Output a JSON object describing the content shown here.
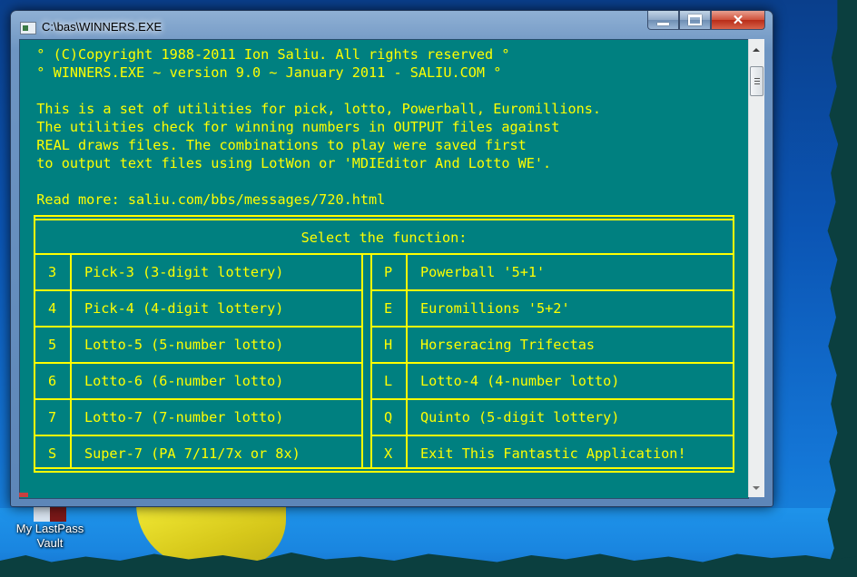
{
  "desktop": {
    "icon_label_line1": "My LastPass",
    "icon_label_line2": "Vault"
  },
  "window": {
    "title": "C:\\bas\\WINNERS.EXE",
    "buttons": {
      "minimize": "minimize",
      "maximize": "maximize",
      "close": "✕"
    }
  },
  "console": {
    "header_lines": [
      "  ° (C)Copyright 1988-2011 Ion Saliu. All rights reserved °",
      "  ° WINNERS.EXE ~ version 9.0 ~ January 2011 - SALIU.COM °",
      "",
      "  This is a set of utilities for pick, lotto, Powerball, Euromillions.",
      "  The utilities check for winning numbers in OUTPUT files against",
      "  REAL draws files. The combinations to play were saved first",
      "  to output text files using LotWon or 'MDIEditor And Lotto WE'.",
      "",
      "  Read more: saliu.com/bbs/messages/720.html"
    ],
    "menu": {
      "title": "Select the function:",
      "left": [
        {
          "key": "3",
          "label": "Pick-3 (3-digit lottery)"
        },
        {
          "key": "4",
          "label": "Pick-4 (4-digit lottery)"
        },
        {
          "key": "5",
          "label": "Lotto-5 (5-number lotto)"
        },
        {
          "key": "6",
          "label": "Lotto-6 (6-number lotto)"
        },
        {
          "key": "7",
          "label": "Lotto-7 (7-number lotto)"
        },
        {
          "key": "S",
          "label": "Super-7 (PA 7/11/7x or 8x)"
        }
      ],
      "right": [
        {
          "key": "P",
          "label": "Powerball '5+1'"
        },
        {
          "key": "E",
          "label": "Euromillions '5+2'"
        },
        {
          "key": "H",
          "label": "Horseracing Trifectas"
        },
        {
          "key": "L",
          "label": "Lotto-4 (4-number lotto)"
        },
        {
          "key": "Q",
          "label": "Quinto (5-digit lottery)"
        },
        {
          "key": "X",
          "label": "Exit This Fantastic Application!"
        }
      ]
    }
  },
  "colors": {
    "console_bg": "#008080",
    "console_fg": "#ffff00"
  }
}
